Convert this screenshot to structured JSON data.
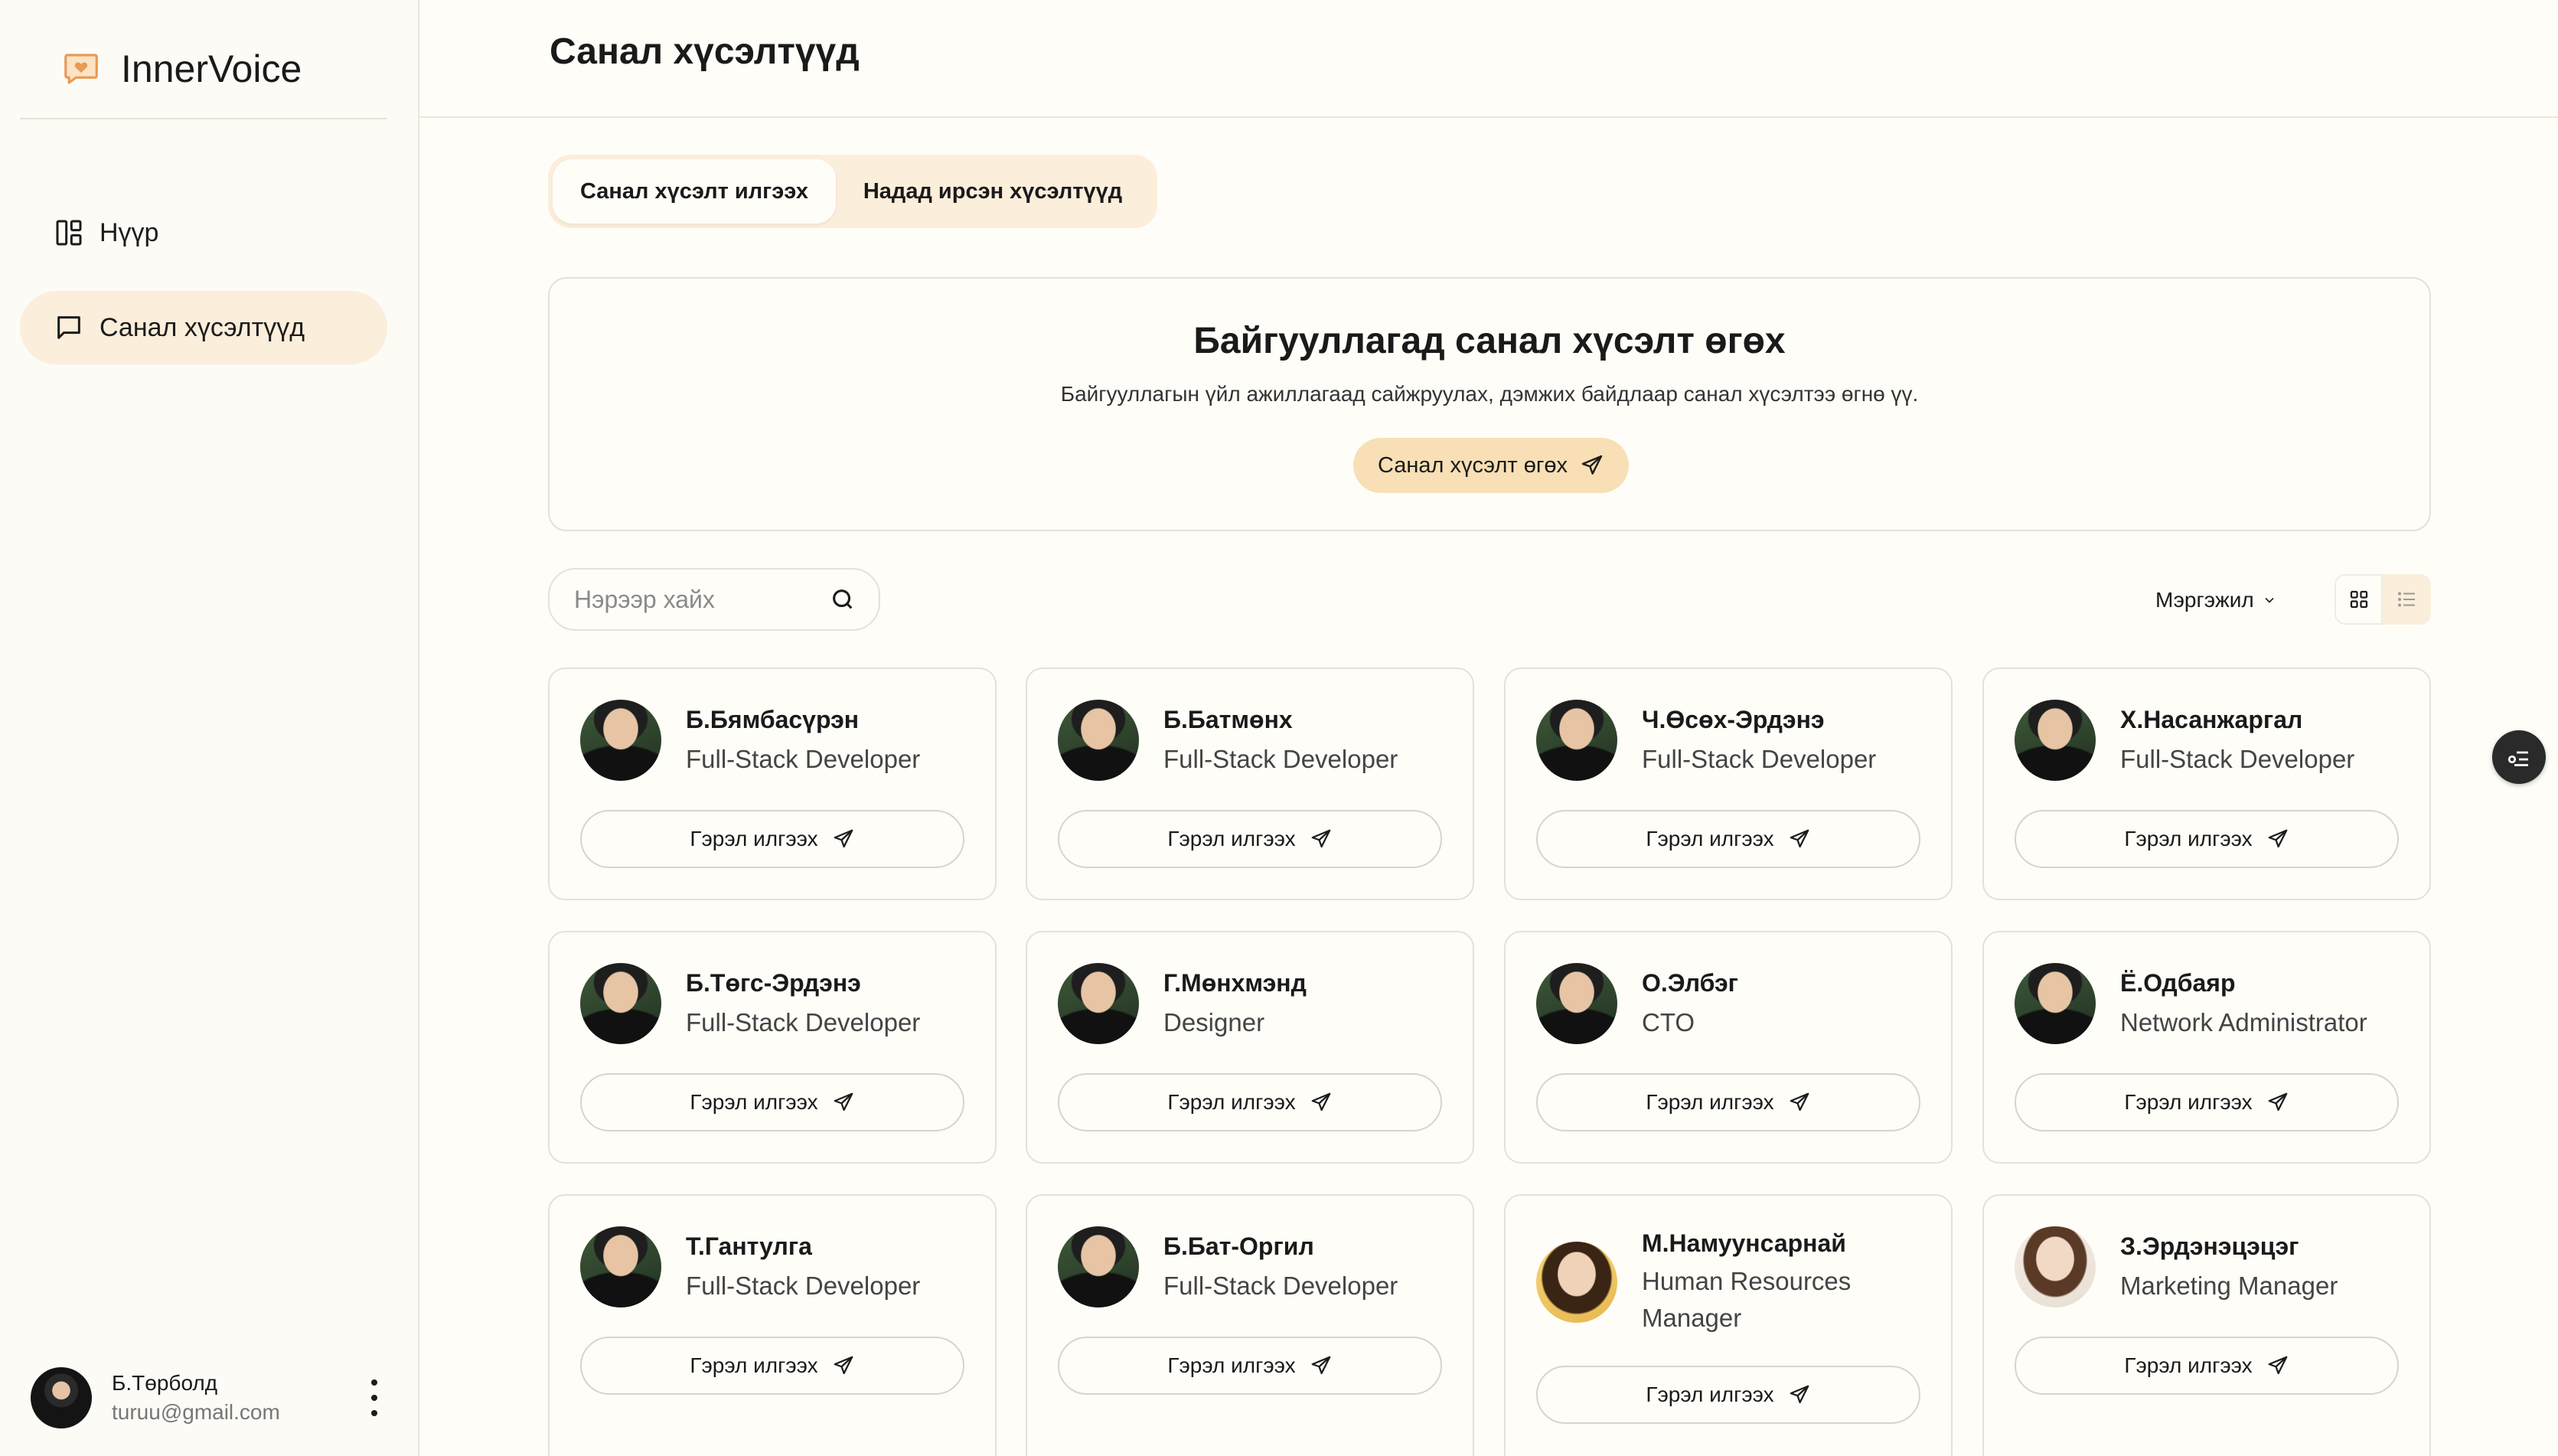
{
  "app": {
    "name": "InnerVoice"
  },
  "sidebar": {
    "items": [
      {
        "label": "Нүүр",
        "icon": "dashboard-icon"
      },
      {
        "label": "Санал хүсэлтүүд",
        "icon": "message-square-icon"
      }
    ]
  },
  "user": {
    "name": "Б.Төрболд",
    "email": "turuu@gmail.com"
  },
  "header": {
    "title": "Санал хүсэлтүүд"
  },
  "tabs": [
    "Санал хүсэлт илгээх",
    "Надад ирсэн хүсэлтүүд"
  ],
  "banner": {
    "title": "Байгууллагад санал хүсэлт өгөх",
    "description": "Байгууллагын үйл ажиллагаад сайжруулах, дэмжих байдлаар санал хүсэлтээ өгнө үү.",
    "button": "Санал хүсэлт өгөх"
  },
  "search": {
    "placeholder": "Нэрээр хайх",
    "value": ""
  },
  "filter": {
    "label": "Мэргэжил"
  },
  "employees": [
    {
      "name": "Б.Бямбасүрэн",
      "role": "Full-Stack Developer",
      "button": "Гэрэл илгээх"
    },
    {
      "name": "Б.Батмөнх",
      "role": "Full-Stack Developer",
      "button": "Гэрэл илгээх"
    },
    {
      "name": "Ч.Өсөх-Эрдэнэ",
      "role": "Full-Stack Developer",
      "button": "Гэрэл илгээх"
    },
    {
      "name": "Х.Насанжаргал",
      "role": "Full-Stack Developer",
      "button": "Гэрэл илгээх"
    },
    {
      "name": "Б.Төгс-Эрдэнэ",
      "role": "Full-Stack Developer",
      "button": "Гэрэл илгээх"
    },
    {
      "name": "Г.Мөнхмэнд",
      "role": "Designer",
      "button": "Гэрэл илгээх"
    },
    {
      "name": "О.Элбэг",
      "role": "CTO",
      "button": "Гэрэл илгээх"
    },
    {
      "name": "Ё.Одбаяр",
      "role": "Network Administrator",
      "button": "Гэрэл илгээх"
    },
    {
      "name": "Т.Гантулга",
      "role": "Full-Stack Developer",
      "button": "Гэрэл илгээх"
    },
    {
      "name": "Б.Бат-Оргил",
      "role": "Full-Stack Developer",
      "button": "Гэрэл илгээх"
    },
    {
      "name": "М.Намуунсарнай",
      "role": "Human Resources Manager",
      "button": "Гэрэл илгээх"
    },
    {
      "name": "З.Эрдэнэцэцэг",
      "role": "Marketing Manager",
      "button": "Гэрэл илгээх"
    }
  ],
  "colors": {
    "accent": "#f8dfb5",
    "accent_light": "#fbeedb",
    "background": "#fffdf8"
  }
}
